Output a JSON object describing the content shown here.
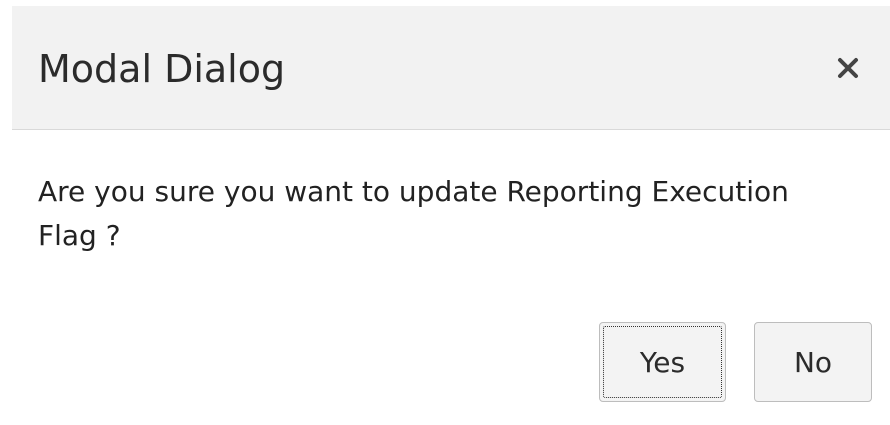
{
  "dialog": {
    "title": "Modal Dialog",
    "close_icon": "close-icon",
    "message": "Are you sure you want to update Reporting Execution Flag ?",
    "buttons": {
      "yes_label": "Yes",
      "no_label": "No"
    }
  },
  "colors": {
    "header_background": "#f2f2f2",
    "button_background": "#f3f3f3",
    "text": "#2b2b2b"
  }
}
